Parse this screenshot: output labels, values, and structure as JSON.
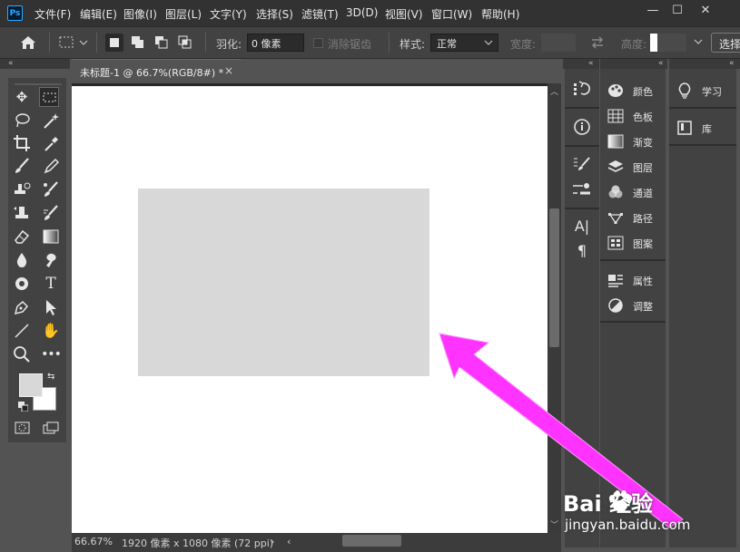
{
  "menubar": {
    "logo": "Ps",
    "items": [
      "文件(F)",
      "编辑(E)",
      "图像(I)",
      "图层(L)",
      "文字(Y)",
      "选择(S)",
      "滤镜(T)",
      "3D(D)",
      "视图(V)",
      "窗口(W)",
      "帮助(H)"
    ],
    "window_buttons": {
      "minimize": "—",
      "maximize": "☐",
      "close": "✕"
    }
  },
  "optionsbar": {
    "home_icon": "home-icon",
    "feather_label": "羽化:",
    "feather_value": "0 像素",
    "antialias_label": "消除锯齿",
    "style_label": "样式:",
    "style_value": "正常",
    "width_label": "宽度:",
    "height_label": "高度:",
    "select_button": "选择"
  },
  "document": {
    "tab_title": "未标题-1 @ 66.7%(RGB/8#) *",
    "tab_close": "×",
    "zoom": "66.67%",
    "info": "1920 像素 x 1080 像素 (72 ppi)"
  },
  "tools": [
    "move-tool-icon",
    "marquee-tool-icon",
    "lasso-tool-icon",
    "magic-wand-icon",
    "crop-tool-icon",
    "eyedropper-icon",
    "brush-icon",
    "pencil-icon",
    "clone-stamp-icon",
    "history-brush-icon",
    "stamp-icon",
    "mixer-brush-icon",
    "eraser-icon",
    "gradient-icon",
    "blur-drop-icon",
    "smudge-icon",
    "dodge-icon",
    "type-tool-icon",
    "pen-tool-icon",
    "path-select-icon",
    "line-tool-icon",
    "hand-tool-icon",
    "zoom-tool-icon",
    "more-tools-icon"
  ],
  "panels": {
    "group1": [
      {
        "label": "颜色",
        "icon": "color-palette-icon"
      },
      {
        "label": "色板",
        "icon": "swatches-grid-icon"
      },
      {
        "label": "渐变",
        "icon": "gradient-square-icon"
      },
      {
        "label": "图层",
        "icon": "layers-icon"
      },
      {
        "label": "通道",
        "icon": "channels-icon"
      },
      {
        "label": "路径",
        "icon": "paths-icon"
      },
      {
        "label": "图案",
        "icon": "pattern-icon"
      }
    ],
    "group2": [
      {
        "label": "属性",
        "icon": "properties-icon"
      },
      {
        "label": "调整",
        "icon": "adjustments-icon"
      }
    ],
    "group3": [
      {
        "label": "学习",
        "icon": "lightbulb-icon"
      },
      {
        "label": "库",
        "icon": "library-icon"
      }
    ]
  },
  "watermark": {
    "brand": "Bai  经验",
    "url": "jingyan.baidu.com"
  },
  "colors": {
    "accent": "#ff33ff",
    "ps_blue": "#31a8ff",
    "canvas": "#ffffff",
    "selection_fill": "#d8d8d8"
  }
}
